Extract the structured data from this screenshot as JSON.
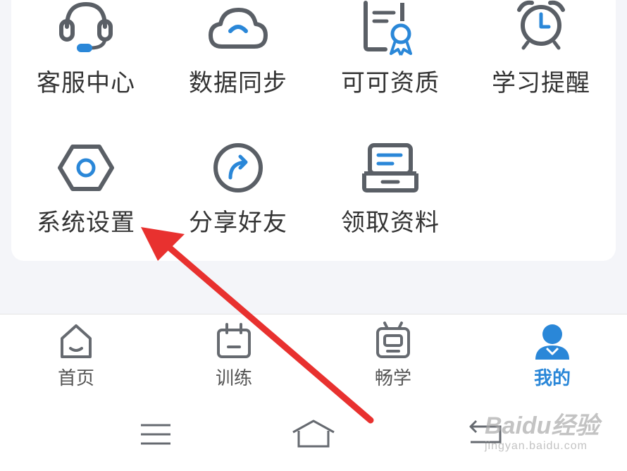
{
  "grid": {
    "row1": [
      {
        "label": "客服中心",
        "icon": "headset-icon"
      },
      {
        "label": "数据同步",
        "icon": "cloud-sync-icon"
      },
      {
        "label": "可可资质",
        "icon": "certificate-icon"
      },
      {
        "label": "学习提醒",
        "icon": "alarm-clock-icon"
      }
    ],
    "row2": [
      {
        "label": "系统设置",
        "icon": "settings-hexagon-icon"
      },
      {
        "label": "分享好友",
        "icon": "share-arrow-icon"
      },
      {
        "label": "领取资料",
        "icon": "inbox-tray-icon"
      }
    ]
  },
  "tabs": [
    {
      "label": "首页",
      "icon": "home-icon",
      "active": false
    },
    {
      "label": "训练",
      "icon": "calendar-icon",
      "active": false
    },
    {
      "label": "畅学",
      "icon": "tv-icon",
      "active": false
    },
    {
      "label": "我的",
      "icon": "profile-icon",
      "active": true
    }
  ],
  "watermark": {
    "brand": "Baidu经验",
    "url": "jingyan.baidu.com"
  },
  "colors": {
    "accent": "#2a87d8",
    "icon_gray": "#5a5f66",
    "arrow_red": "#e8312f",
    "background": "#f4f5f9"
  }
}
